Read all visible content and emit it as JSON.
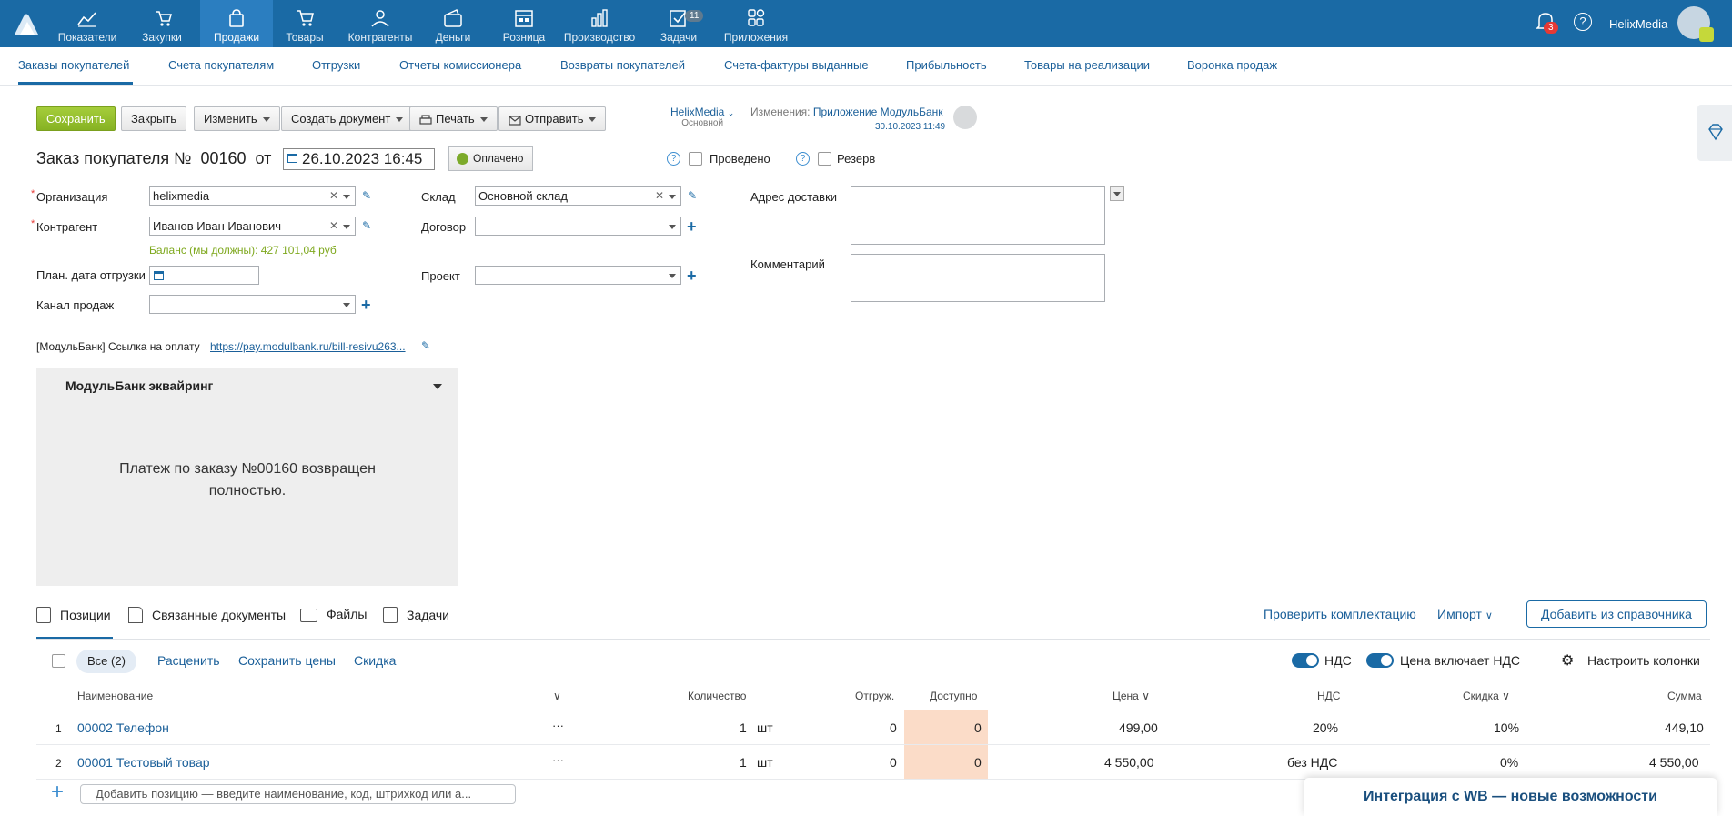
{
  "topnav": {
    "items": [
      {
        "label": "Показатели",
        "icon": "chart-line-icon"
      },
      {
        "label": "Закупки",
        "icon": "cart-hand-icon"
      },
      {
        "label": "Продажи",
        "icon": "shopping-bag-icon",
        "active": true
      },
      {
        "label": "Товары",
        "icon": "cart-icon"
      },
      {
        "label": "Контрагенты",
        "icon": "people-icon"
      },
      {
        "label": "Деньги",
        "icon": "wallet-icon"
      },
      {
        "label": "Розница",
        "icon": "store-icon"
      },
      {
        "label": "Производство",
        "icon": "bars-icon"
      },
      {
        "label": "Задачи",
        "icon": "task-check-icon",
        "badge": "11"
      },
      {
        "label": "Приложения",
        "icon": "apps-grid-icon"
      }
    ],
    "notifications_badge": "3",
    "help": "?",
    "account_name": "HelixMedia"
  },
  "subnav": {
    "items": [
      "Заказы покупателей",
      "Счета покупателям",
      "Отгрузки",
      "Отчеты комиссионера",
      "Возвраты покупателей",
      "Счета-фактуры выданные",
      "Прибыльность",
      "Товары на реализации",
      "Воронка продаж"
    ]
  },
  "toolbar": {
    "save": "Сохранить",
    "close": "Закрыть",
    "edit": "Изменить",
    "create_doc": "Создать документ",
    "print": "Печать",
    "send": "Отправить"
  },
  "owner": {
    "name": "HelixMedia",
    "sub": "Основной"
  },
  "changes": {
    "label": "Изменения:",
    "by": "Приложение МодульБанк",
    "time": "30.10.2023 11:49"
  },
  "doc": {
    "title_prefix": "Заказ покупателя №",
    "number": "00160",
    "from": "от",
    "date": "26.10.2023 16:45",
    "paid": "Оплачено",
    "posted": "Проведено",
    "reserve": "Резерв"
  },
  "form": {
    "org_label": "Организация",
    "org_value": "helixmedia",
    "counterparty_label": "Контрагент",
    "counterparty_value": "Иванов Иван Иванович",
    "balance_label": "Баланс (мы должны):",
    "balance_value": "427 101,04 руб",
    "ship_date_label": "План. дата отгрузки",
    "channel_label": "Канал продаж",
    "warehouse_label": "Склад",
    "warehouse_value": "Основной склад",
    "contract_label": "Договор",
    "project_label": "Проект",
    "delivery_label": "Адрес доставки",
    "comment_label": "Комментарий"
  },
  "payment_link": {
    "label": "[МодульБанк] Ссылка на оплату",
    "url": "https://pay.modulbank.ru/bill-resivu263..."
  },
  "modulbank": {
    "title": "МодульБанк эквайринг",
    "message": "Платеж по заказу №00160 возвращен полностью."
  },
  "tabs": {
    "positions": "Позиции",
    "related": "Связанные документы",
    "files": "Файлы",
    "tasks": "Задачи",
    "check": "Проверить комплектацию",
    "import": "Импорт",
    "add_from_catalog": "Добавить из справочника"
  },
  "filters": {
    "all": "Все (2)",
    "reprice": "Расценить",
    "save_prices": "Сохранить цены",
    "discount": "Скидка",
    "vat": "НДС",
    "price_incl_vat": "Цена включает НДС",
    "configure": "Настроить колонки"
  },
  "table": {
    "headers": {
      "name": "Наименование",
      "qty": "Количество",
      "shipped": "Отгруж.",
      "avail": "Доступно",
      "price": "Цена",
      "vat": "НДС",
      "discount": "Скидка",
      "sum": "Сумма"
    },
    "rows": [
      {
        "n": "1",
        "name": "00002 Телефон",
        "more": "···",
        "qty": "1",
        "unit": "шт",
        "shipped": "0",
        "avail": "0",
        "price": "499,00",
        "vat": "20%",
        "discount": "10%",
        "sum": "449,10"
      },
      {
        "n": "2",
        "name": "00001 Тестовый товар",
        "more": "···",
        "qty": "1",
        "unit": "шт",
        "shipped": "0",
        "avail": "0",
        "price": "4 550,00",
        "vat": "без НДС",
        "discount": "0%",
        "sum": "4 550,00"
      }
    ],
    "add_placeholder": "Добавить позицию — введите наименование, код, штрихкод или а..."
  },
  "promo": "Интеграция с WB — новые возможности"
}
